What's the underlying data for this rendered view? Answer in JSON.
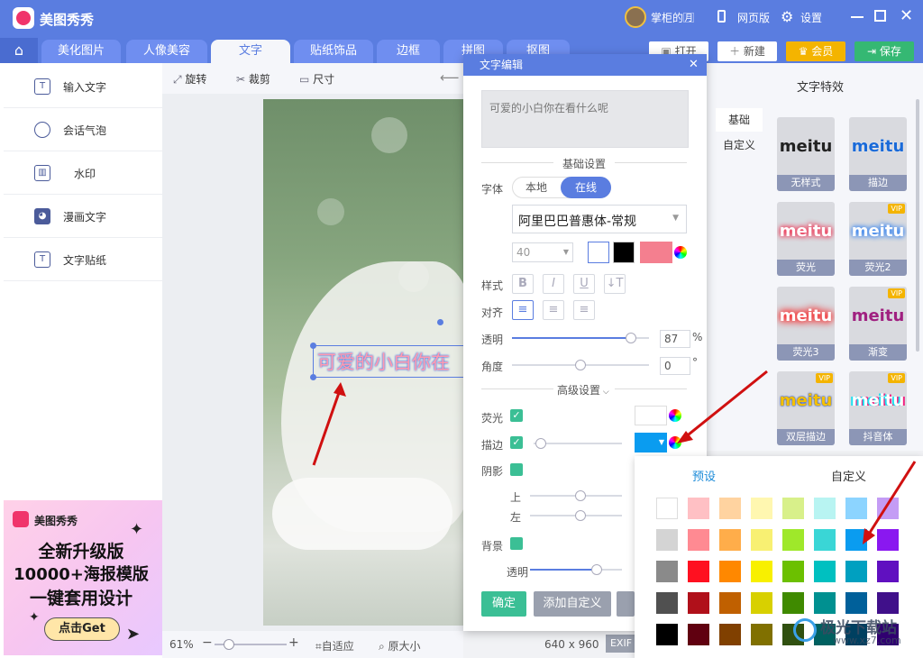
{
  "app": {
    "name": "美图秀秀",
    "user": "掌柜的🈷",
    "web_version": "网页版",
    "settings": "设置"
  },
  "tabs": [
    "美化图片",
    "人像美容",
    "文字",
    "贴纸饰品",
    "边框",
    "拼图",
    "抠图"
  ],
  "top_buttons": {
    "open": "打开",
    "new": "新建",
    "vip": "会员",
    "save": "保存"
  },
  "toolbar": {
    "rotate": "旋转",
    "crop": "裁剪",
    "size": "尺寸"
  },
  "sidebar": [
    {
      "label": "输入文字",
      "icon": "text-box-icon"
    },
    {
      "label": "会话气泡",
      "icon": "speech-bubble-icon"
    },
    {
      "label": "水印",
      "icon": "watermark-icon"
    },
    {
      "label": "漫画文字",
      "icon": "comic-text-icon"
    },
    {
      "label": "文字贴纸",
      "icon": "text-sticker-icon"
    }
  ],
  "ad": {
    "brand": "美图秀秀",
    "line1": "全新升级版",
    "line2": "10000+海报模版",
    "line3": "一键套用设计",
    "button": "点击Get"
  },
  "canvas": {
    "overlay_text": "可爱的小白你在"
  },
  "status": {
    "zoom": "61%",
    "fit": "自适应",
    "original": "原大小",
    "dimensions": "640 x 960",
    "exif": "EXIF"
  },
  "dialog": {
    "title": "文字编辑",
    "text_value": "可爱的小白你在看什么呢",
    "basic_settings": "基础设置",
    "font_label": "字体",
    "font_local": "本地",
    "font_online": "在线",
    "font_name": "阿里巴巴普惠体-常规",
    "font_size": "40",
    "style_label": "样式",
    "align_label": "对齐",
    "opacity_label": "透明",
    "opacity_value": "87",
    "opacity_unit": "%",
    "opacity_level": 0.87,
    "angle_label": "角度",
    "angle_value": "0",
    "angle_unit": "°",
    "advanced_settings": "高级设置",
    "glow_label": "荧光",
    "stroke_label": "描边",
    "shadow_label": "阴影",
    "shadow_up": "上",
    "shadow_left": "左",
    "background_label": "背景",
    "bg_opacity_label": "透明",
    "confirm": "确定",
    "add_custom": "添加自定义",
    "text_color": "#000000",
    "bg_color": "#f47f8f",
    "stroke_color": "#0a9cf0"
  },
  "effects": {
    "title": "文字特效",
    "tab_basic": "基础",
    "tab_custom": "自定义",
    "items": [
      {
        "label": "无样式",
        "sample": "meitu",
        "vip": false
      },
      {
        "label": "描边",
        "sample": "meitu",
        "vip": false
      },
      {
        "label": "荧光",
        "sample": "meitu",
        "vip": false
      },
      {
        "label": "荧光2",
        "sample": "meitu",
        "vip": true
      },
      {
        "label": "荧光3",
        "sample": "meitu",
        "vip": false
      },
      {
        "label": "渐变",
        "sample": "meitu",
        "vip": true
      },
      {
        "label": "双层描边",
        "sample": "meitu",
        "vip": true
      },
      {
        "label": "抖音体",
        "sample": "meitu",
        "vip": true
      }
    ],
    "vip_badge": "VIP"
  },
  "palette": {
    "tab_preset": "预设",
    "tab_custom": "自定义",
    "rows": [
      [
        "#ffffff",
        "#ffc0c4",
        "#ffd3a0",
        "#fff7b0",
        "#d8f08a",
        "#b8f4f2",
        "#8cd4ff",
        "#c49cf5"
      ],
      [
        "#d4d4d4",
        "#ff8a92",
        "#ffad4a",
        "#f8f072",
        "#9fe82a",
        "#3ad6d6",
        "#0a9cf0",
        "#8a18f0"
      ],
      [
        "#8a8a8a",
        "#ff1020",
        "#ff8800",
        "#f8f000",
        "#6cc000",
        "#00c0c0",
        "#00a0c0",
        "#6010c0"
      ],
      [
        "#505050",
        "#b0101a",
        "#c06000",
        "#d8d000",
        "#3f8a00",
        "#009090",
        "#00609a",
        "#40108a"
      ],
      [
        "#000000",
        "#600010",
        "#804000",
        "#807000",
        "#305010",
        "#006060",
        "#004060",
        "#300070"
      ]
    ]
  },
  "watermark": {
    "text": "极光下载站",
    "url": "www.xz7.com"
  }
}
